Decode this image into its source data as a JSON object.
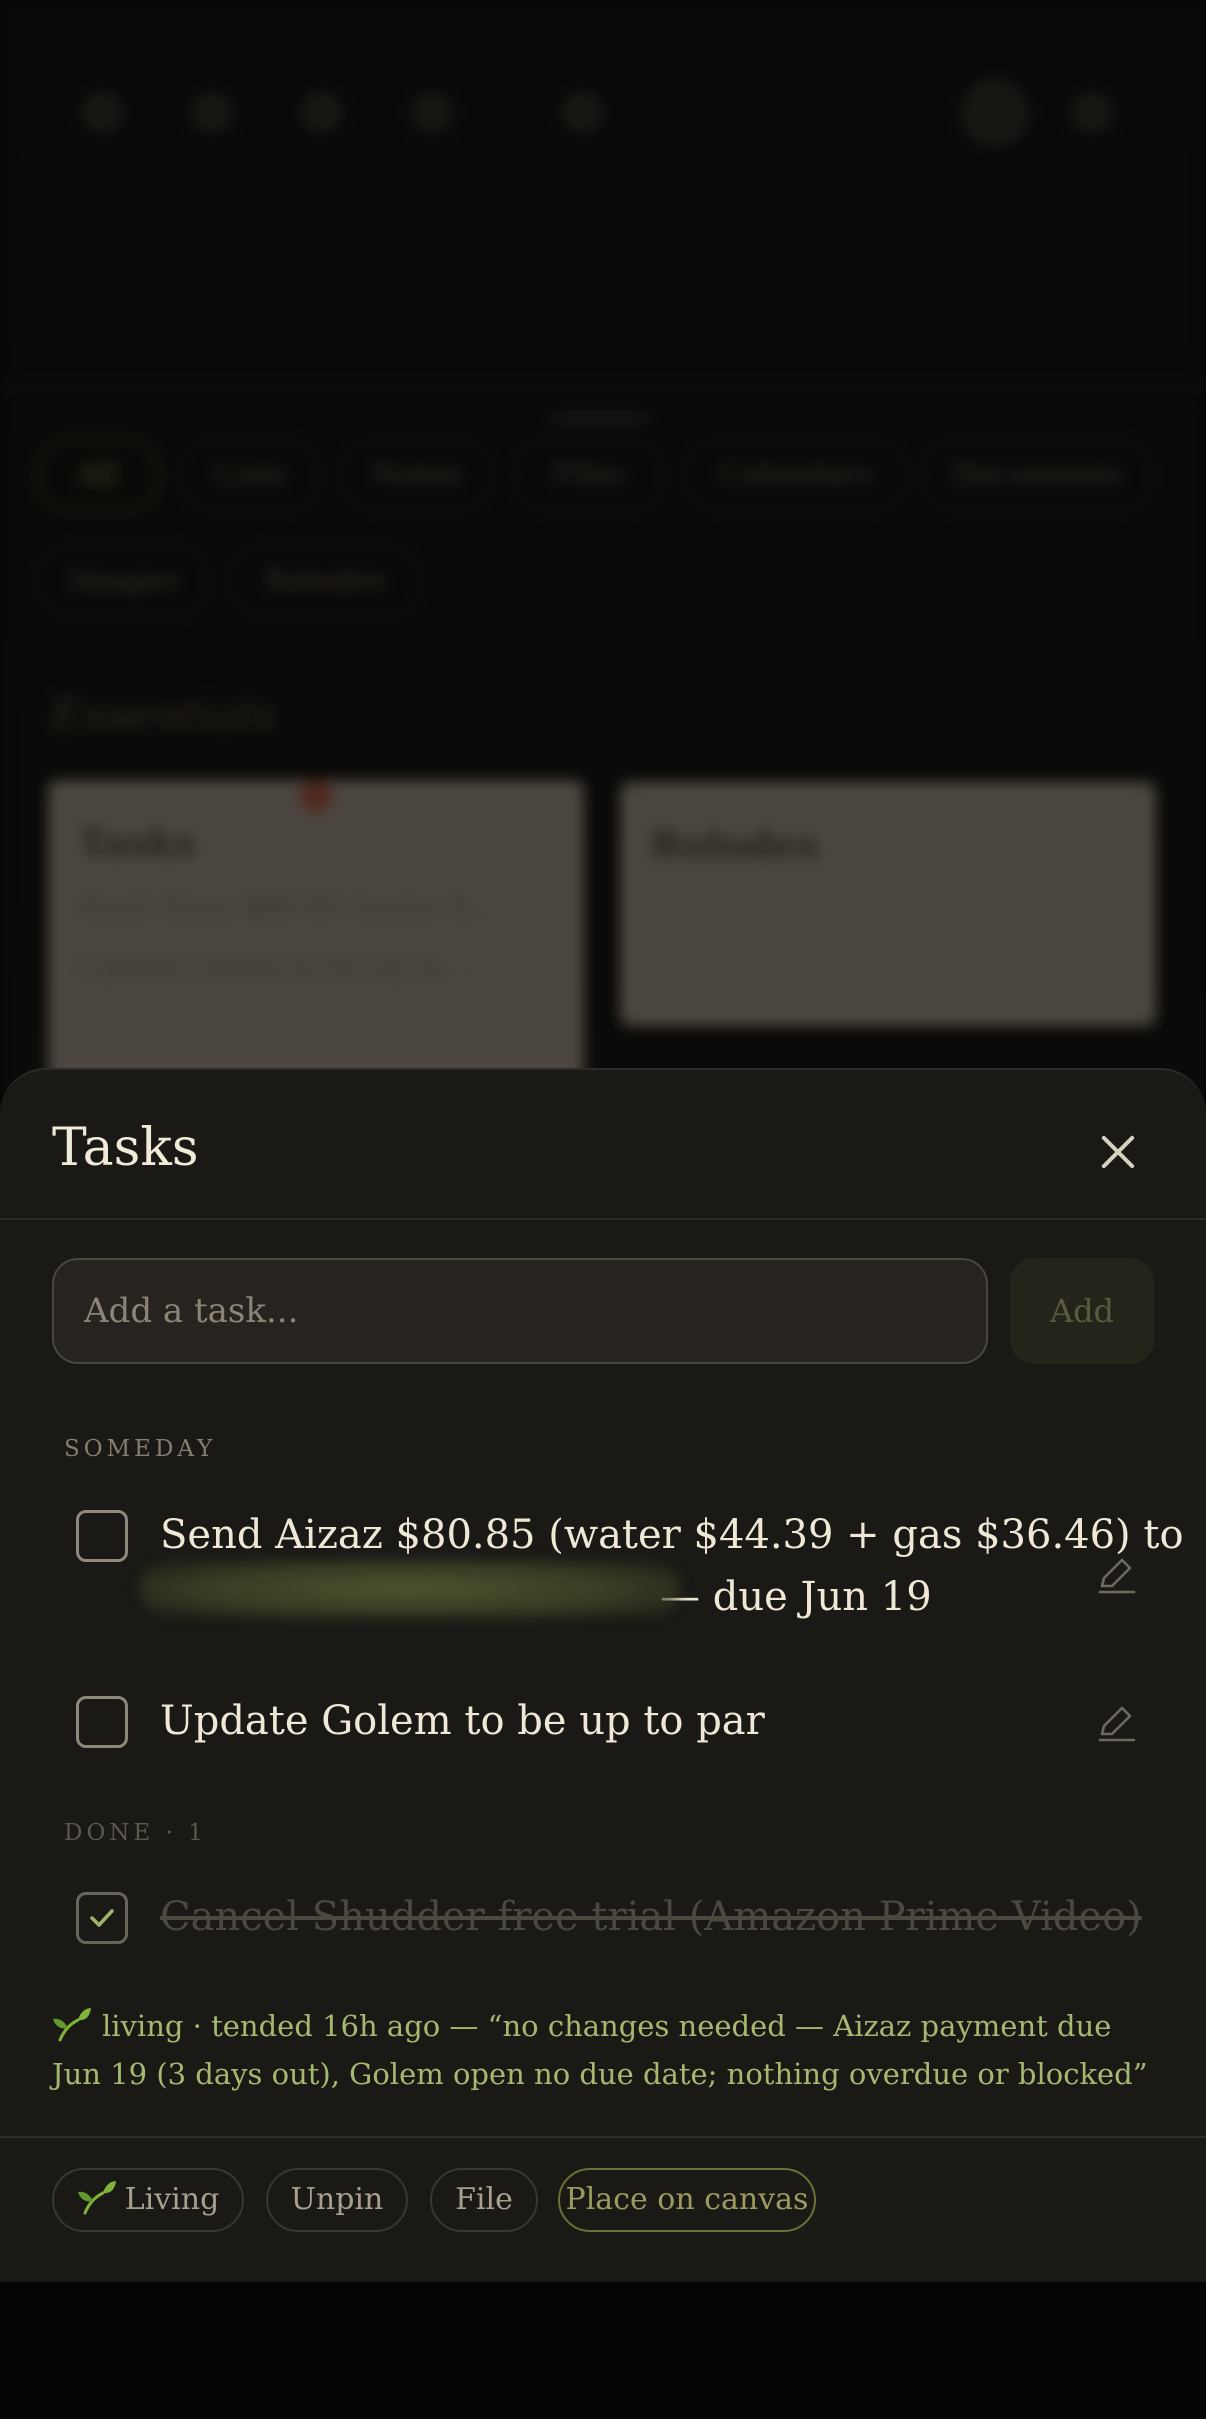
{
  "background": {
    "filter_chips": [
      "All",
      "Lists",
      "Notes",
      "Files",
      "Calendars",
      "Documents",
      "Images",
      "Rolodex"
    ],
    "section_title": "Essentials",
    "cards": [
      {
        "title": "Tasks",
        "rows": [
          "Send Aizaz $80.85 (water $...",
          "Update Golem to be up to ..."
        ]
      },
      {
        "title": "Rolodex",
        "rows": []
      }
    ]
  },
  "sheet": {
    "title": "Tasks",
    "input_placeholder": "Add a task...",
    "add_label": "Add",
    "sections": {
      "someday_label": "SOMEDAY",
      "done_label": "DONE · 1"
    },
    "tasks_someday": [
      {
        "line1": "Send Aizaz $80.85 (water $44.39 + gas $36.46) to",
        "line2": "— due Jun 19",
        "checked": false
      },
      {
        "line1": "Update Golem to be up to par",
        "checked": false
      }
    ],
    "tasks_done": [
      {
        "line1": "Cancel Shudder free trial (Amazon Prime Video)",
        "checked": true
      }
    ],
    "living_note": "living · tended 16h ago — “no changes needed — Aizaz payment due Jun 19 (3 days out), Golem open no due date; nothing overdue or blocked”",
    "footer": {
      "living": "Living",
      "unpin": "Unpin",
      "file": "File",
      "place": "Place on canvas"
    },
    "colors": {
      "sheet_bg": "#1b1916",
      "accent_green": "#a5b870",
      "add_button_bg": "#24241a"
    }
  }
}
